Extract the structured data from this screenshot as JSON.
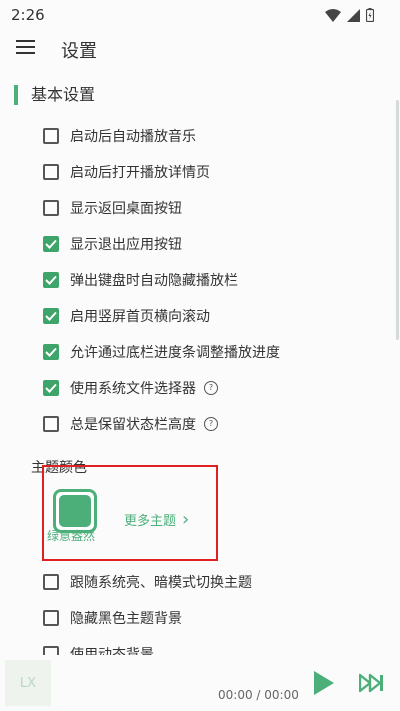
{
  "status": {
    "time": "2:26"
  },
  "header": {
    "title": "设置"
  },
  "section": {
    "title": "基本设置"
  },
  "options": [
    {
      "label": "启动后自动播放音乐",
      "checked": false,
      "help": false
    },
    {
      "label": "启动后打开播放详情页",
      "checked": false,
      "help": false
    },
    {
      "label": "显示返回桌面按钮",
      "checked": false,
      "help": false
    },
    {
      "label": "显示退出应用按钮",
      "checked": true,
      "help": false
    },
    {
      "label": "弹出键盘时自动隐藏播放栏",
      "checked": true,
      "help": false
    },
    {
      "label": "启用竖屏首页横向滚动",
      "checked": true,
      "help": false
    },
    {
      "label": "允许通过底栏进度条调整播放进度",
      "checked": true,
      "help": false
    },
    {
      "label": "使用系统文件选择器",
      "checked": true,
      "help": true
    },
    {
      "label": "总是保留状态栏高度",
      "checked": false,
      "help": true
    }
  ],
  "theme": {
    "section_label": "主题颜色",
    "current_name": "绿意盎然",
    "more_label": "更多主题",
    "more_chevron": "›",
    "accent": "#4caf7a"
  },
  "options2": [
    {
      "label": "跟随系统亮、暗模式切换主题",
      "checked": false
    },
    {
      "label": "隐藏黑色主题背景",
      "checked": false
    },
    {
      "label": "使用动态背景",
      "checked": false
    }
  ],
  "player": {
    "logo_text": "LX",
    "time_text": "00:00 / 00:00"
  },
  "colors": {
    "accent": "#4caf7a",
    "check": "#3fa46a",
    "highlight_box": "#e02020"
  }
}
